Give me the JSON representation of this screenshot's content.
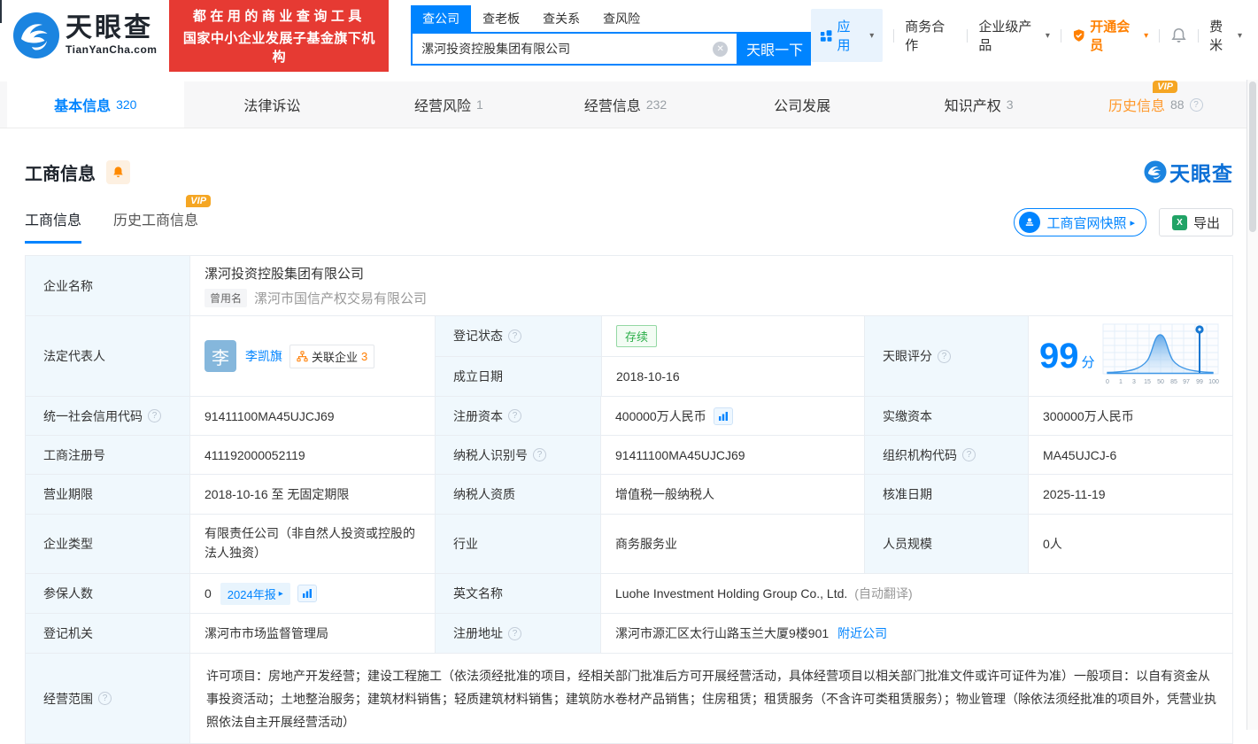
{
  "colors": {
    "primary": "#0084ff",
    "red_banner": "#e63a33",
    "vip_orange": "#f5a623",
    "member_orange": "#ff8000",
    "status_green": "#2bae49",
    "label_cell_bg": "#f0f8fd"
  },
  "icons": {
    "clear": "✕",
    "caret": "▾",
    "arrow_right": "▸",
    "help": "?",
    "vip": "VIP",
    "excel": "X"
  },
  "header": {
    "logo_title": "天眼查",
    "logo_domain": "TianYanCha.com",
    "slogan_line1": "都在用的商业查询工具",
    "slogan_line2": "国家中小企业发展子基金旗下机构",
    "search_tabs": [
      {
        "label": "查公司"
      },
      {
        "label": "查老板"
      },
      {
        "label": "查关系"
      },
      {
        "label": "查风险"
      }
    ],
    "search_value": "漯河投资控股集团有限公司",
    "search_button": "天眼一下",
    "nav_apps": "应用",
    "nav_coop": "商务合作",
    "nav_enterprise": "企业级产品",
    "nav_member": "开通会员",
    "nav_user": "费米"
  },
  "tabbar": {
    "tabs": [
      {
        "label": "基本信息",
        "count": "320"
      },
      {
        "label": "法律诉讼"
      },
      {
        "label": "经营风险",
        "count": "1"
      },
      {
        "label": "经营信息",
        "count": "232"
      },
      {
        "label": "公司发展"
      },
      {
        "label": "知识产权",
        "count": "3"
      },
      {
        "label": "历史信息",
        "count": "88"
      }
    ]
  },
  "section": {
    "title": "工商信息",
    "brand": "天眼查",
    "subtab_current": "工商信息",
    "subtab_history": "历史工商信息",
    "snapshot_button": "工商官网快照",
    "export_button": "导出"
  },
  "table": {
    "name_label": "企业名称",
    "name_value": "漯河投资控股集团有限公司",
    "former_badge": "曾用名",
    "former_value": "漯河市国信产权交易有限公司",
    "legal_label": "法定代表人",
    "legal_avatar": "李",
    "legal_name": "李凯旗",
    "related_label": "关联企业",
    "related_count": "3",
    "status_label": "登记状态",
    "status_value": "存续",
    "established_label": "成立日期",
    "established_value": "2018-10-16",
    "score_label": "天眼评分",
    "score_value": "99",
    "score_unit": "分",
    "credit_code_label": "统一社会信用代码",
    "credit_code_value": "91411100MA45UJCJ69",
    "reg_capital_label": "注册资本",
    "reg_capital_value": "400000万人民币",
    "paid_capital_label": "实缴资本",
    "paid_capital_value": "300000万人民币",
    "reg_no_label": "工商注册号",
    "reg_no_value": "411192000052119",
    "taxpayer_label": "纳税人识别号",
    "taxpayer_value": "91411100MA45UJCJ69",
    "org_code_label": "组织机构代码",
    "org_code_value": "MA45UJCJ-6",
    "term_label": "营业期限",
    "term_value": "2018-10-16 至 无固定期限",
    "tax_quality_label": "纳税人资质",
    "tax_quality_value": "增值税一般纳税人",
    "approval_label": "核准日期",
    "approval_value": "2025-11-19",
    "type_label": "企业类型",
    "type_value": "有限责任公司（非自然人投资或控股的法人独资）",
    "industry_label": "行业",
    "industry_value": "商务服务业",
    "staff_label": "人员规模",
    "staff_value": "0人",
    "insured_label": "参保人数",
    "insured_value": "0",
    "report_badge": "2024年报",
    "en_name_label": "英文名称",
    "en_name_value": "Luohe Investment Holding Group Co., Ltd.",
    "en_name_note": "(自动翻译)",
    "authority_label": "登记机关",
    "authority_value": "漯河市市场监督管理局",
    "address_label": "注册地址",
    "address_value": "漯河市源汇区太行山路玉兰大厦9楼901",
    "nearby_link": "附近公司",
    "scope_label": "经营范围",
    "scope_value": "许可项目：房地产开发经营；建设工程施工（依法须经批准的项目，经相关部门批准后方可开展经营活动，具体经营项目以相关部门批准文件或许可证件为准）一般项目：以自有资金从事投资活动；土地整治服务；建筑材料销售；轻质建筑材料销售；建筑防水卷材产品销售；住房租赁；租赁服务（不含许可类租赁服务）；物业管理（除依法须经批准的项目外，凭营业执照依法自主开展经营活动）"
  },
  "chart_data": {
    "type": "area",
    "title": "天眼评分",
    "score": 99,
    "score_unit": "分",
    "x_ticks": [
      "0",
      "1",
      "3",
      "15",
      "50",
      "85",
      "97",
      "99",
      "100"
    ],
    "marker_tick": "99",
    "shape": "bell distribution curve peaking near tick 50, vertical marker pin at 99",
    "grid": true,
    "legend": false
  }
}
